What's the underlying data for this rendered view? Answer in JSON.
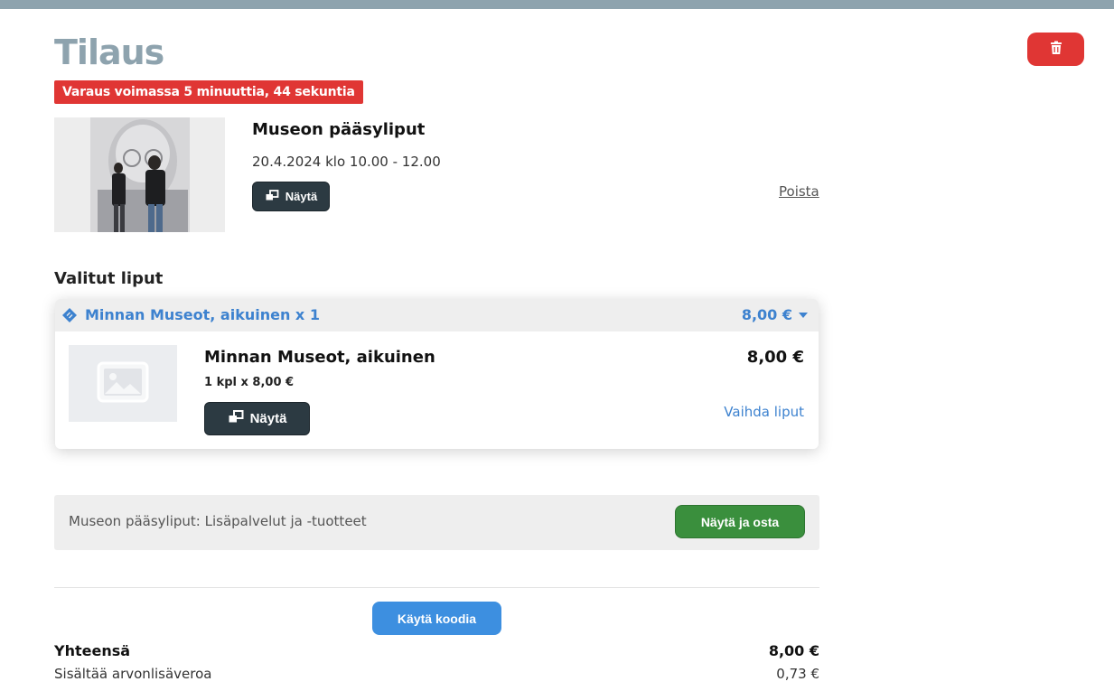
{
  "page": {
    "title": "Tilaus"
  },
  "timer": {
    "text": "Varaus voimassa 5 minuuttia, 44 sekuntia"
  },
  "delete_button": {
    "icon": "trash-icon"
  },
  "event": {
    "title": "Museon pääsyliput",
    "date": "20.4.2024 klo 10.00 - 12.00",
    "show_label": "Näytä",
    "remove_label": "Poista"
  },
  "tickets": {
    "section_title": "Valitut liput",
    "summary_label": "Minnan Museot, aikuinen x 1",
    "summary_price": "8,00 €",
    "item": {
      "name": "Minnan Museot, aikuinen",
      "qty_text": "1 kpl x 8,00 €",
      "price": "8,00 €",
      "show_label": "Näytä",
      "change_label": "Vaihda liput"
    }
  },
  "extras": {
    "text": "Museon pääsyliput: Lisäpalvelut ja -tuotteet",
    "button_label": "Näytä ja osta"
  },
  "code": {
    "button_label": "Käytä koodia"
  },
  "totals": {
    "total_label": "Yhteensä",
    "total_value": "8,00 €",
    "vat_label": "Sisältää arvonlisäveroa",
    "vat_value": "0,73 €"
  },
  "colors": {
    "accent_blue": "#3d82cf",
    "danger_red": "#e03634",
    "success_green": "#3a8f3d",
    "dark_button": "#2c3a42",
    "title_gray": "#8ea3ae"
  }
}
